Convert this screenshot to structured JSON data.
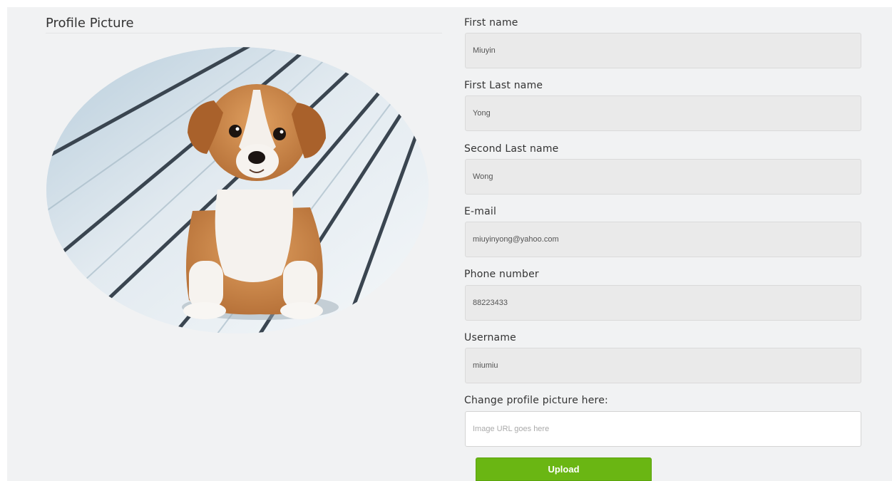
{
  "profile": {
    "section_title": "Profile Picture",
    "picture_icon": "puppy-photo"
  },
  "form": {
    "first_name": {
      "label": "First name",
      "value": "Miuyin"
    },
    "first_last_name": {
      "label": "First Last name",
      "value": "Yong"
    },
    "second_last_name": {
      "label": "Second Last name",
      "value": "Wong"
    },
    "email": {
      "label": "E-mail",
      "value": "miuyinyong@yahoo.com"
    },
    "phone": {
      "label": "Phone number",
      "value": "88223433"
    },
    "username": {
      "label": "Username",
      "value": "miumiu"
    },
    "picture_url": {
      "label": "Change profile picture here:",
      "value": "",
      "placeholder": "Image URL goes here"
    },
    "upload_label": "Upload"
  },
  "colors": {
    "upload_button": "#6ab613",
    "input_background": "#eaeaea",
    "page_background": "#f1f2f3"
  }
}
